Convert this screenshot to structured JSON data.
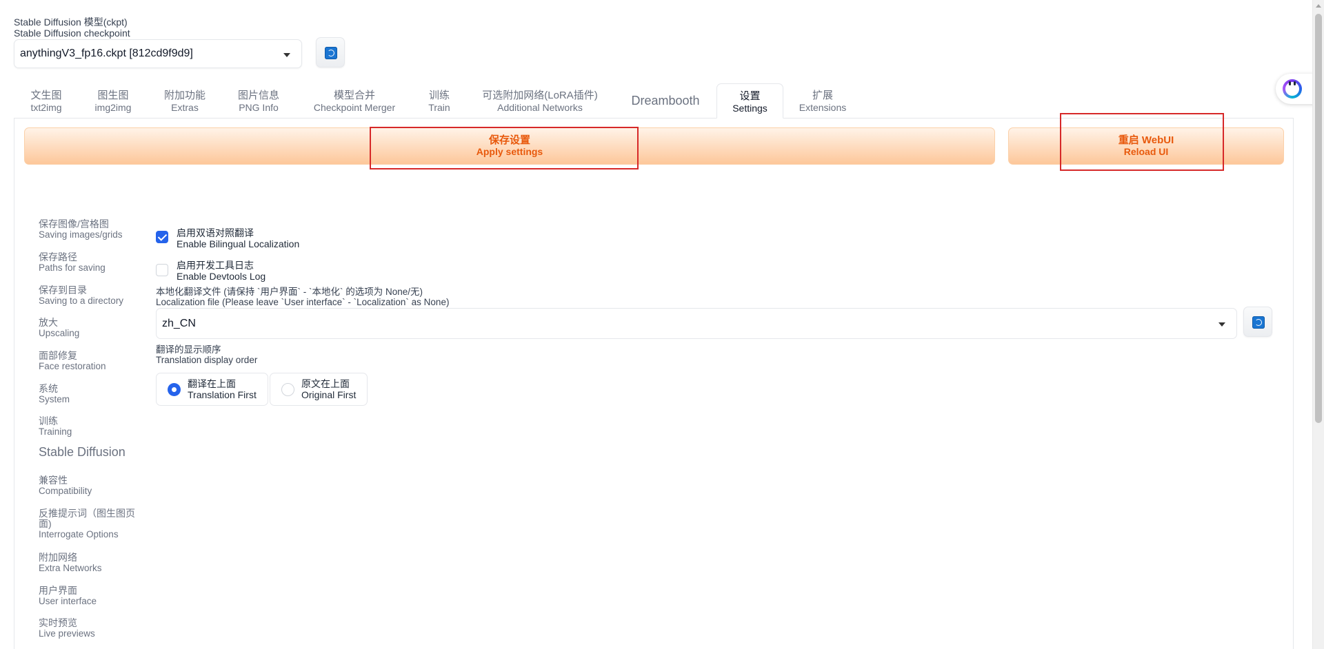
{
  "checkpoint": {
    "label_zh": "Stable Diffusion 模型(ckpt)",
    "label_en": "Stable Diffusion checkpoint",
    "value": "anythingV3_fp16.ckpt [812cd9f9d9]",
    "refresh_icon": "refresh-icon"
  },
  "tabs": [
    {
      "zh": "文生图",
      "en": "txt2img"
    },
    {
      "zh": "图生图",
      "en": "img2img"
    },
    {
      "zh": "附加功能",
      "en": "Extras"
    },
    {
      "zh": "图片信息",
      "en": "PNG Info"
    },
    {
      "zh": "模型合并",
      "en": "Checkpoint Merger"
    },
    {
      "zh": "训练",
      "en": "Train"
    },
    {
      "zh": "可选附加网络(LoRA插件)",
      "en": "Additional Networks"
    },
    {
      "label": "Dreambooth"
    },
    {
      "zh": "设置",
      "en": "Settings",
      "active": true
    },
    {
      "zh": "扩展",
      "en": "Extensions"
    }
  ],
  "actions": {
    "apply_zh": "保存设置",
    "apply_en": "Apply settings",
    "reload_zh": "重启 WebUI",
    "reload_en": "Reload UI"
  },
  "sidebar": [
    {
      "zh": "保存图像/宫格图",
      "en": "Saving images/grids"
    },
    {
      "zh": "保存路径",
      "en": "Paths for saving"
    },
    {
      "zh": "保存到目录",
      "en": "Saving to a directory"
    },
    {
      "zh": "放大",
      "en": "Upscaling"
    },
    {
      "zh": "面部修复",
      "en": "Face restoration"
    },
    {
      "zh": "系统",
      "en": "System"
    },
    {
      "zh": "训练",
      "en": "Training"
    },
    {
      "label": "Stable Diffusion"
    },
    {
      "zh": "兼容性",
      "en": "Compatibility"
    },
    {
      "zh": "反推提示词（图生图页面)",
      "en": "Interrogate Options"
    },
    {
      "zh": "附加网络",
      "en": "Extra Networks"
    },
    {
      "zh": "用户界面",
      "en": "User interface"
    },
    {
      "zh": "实时预览",
      "en": "Live previews"
    }
  ],
  "settings": {
    "bilingual": {
      "zh": "启用双语对照翻译",
      "en": "Enable Bilingual Localization",
      "checked": true
    },
    "devtools": {
      "zh": "启用开发工具日志",
      "en": "Enable Devtools Log",
      "checked": false
    },
    "localization_file": {
      "label_zh": "本地化翻译文件 (请保持 `用户界面` - `本地化` 的选项为 None/无)",
      "label_en": "Localization file (Please leave `User interface` - `Localization` as None)",
      "value": "zh_CN"
    },
    "display_order": {
      "label_zh": "翻译的显示顺序",
      "label_en": "Translation display order",
      "options": [
        {
          "zh": "翻译在上面",
          "en": "Translation First",
          "selected": true
        },
        {
          "zh": "原文在上面",
          "en": "Original First",
          "selected": false
        }
      ]
    }
  },
  "colors": {
    "accent_blue": "#2563eb",
    "orange_text": "#e8590c",
    "highlight_red": "#d62828"
  }
}
